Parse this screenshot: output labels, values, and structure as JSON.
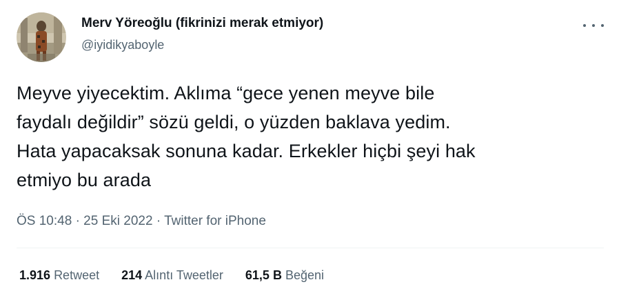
{
  "tweet": {
    "author_name": "Merv Yöreoğlu (fikrinizi merak etmiyor)",
    "author_handle": "@iyidikyaboyle",
    "more_icon": "more-horizontal-icon",
    "text_lines": [
      "Meyve yiyecektim. Aklıma “gece yenen meyve bile",
      "faydalı değildir” sözü geldi, o yüzden baklava yedim.",
      "Hata yapacaksak sonuna kadar. Erkekler hiçbi şeyi hak",
      "etmiyo bu arada"
    ],
    "time": "ÖS 10:48",
    "separator": "·",
    "date": "25 Eki 2022",
    "source": "Twitter for iPhone"
  },
  "stats": {
    "retweets": {
      "count": "1.916",
      "label": "Retweet"
    },
    "quotes": {
      "count": "214",
      "label": "Alıntı Tweetler"
    },
    "likes": {
      "count": "61,5 B",
      "label": "Beğeni"
    }
  },
  "colors": {
    "text_primary": "#0f1419",
    "text_secondary": "#536471",
    "divider": "#eff3f4"
  }
}
